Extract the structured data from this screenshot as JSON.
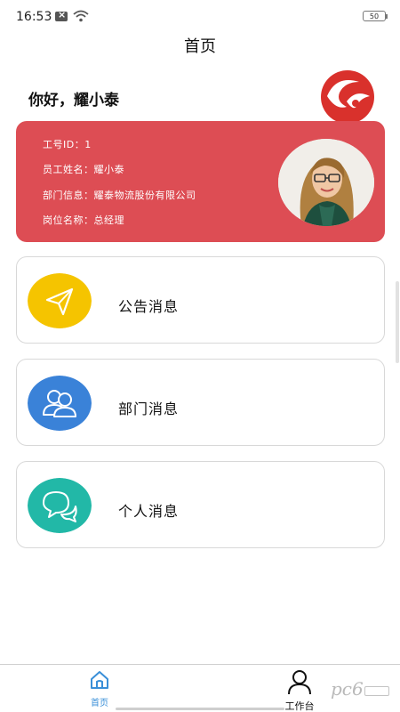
{
  "status": {
    "time": "16:53",
    "battery": "50"
  },
  "header": {
    "title": "首页"
  },
  "greeting": "你好，耀小泰",
  "profile": {
    "rows": [
      {
        "label": "工号ID：",
        "value": "1"
      },
      {
        "label": "员工姓名：",
        "value": "耀小泰"
      },
      {
        "label": "部门信息：",
        "value": "耀泰物流股份有限公司"
      },
      {
        "label": "岗位名称：",
        "value": "总经理"
      }
    ],
    "card_color": "#dd4d54"
  },
  "messages": [
    {
      "label": "公告消息",
      "icon": "send-icon",
      "color": "#f5c400"
    },
    {
      "label": "部门消息",
      "icon": "users-icon",
      "color": "#3a82d8"
    },
    {
      "label": "个人消息",
      "icon": "chat-icon",
      "color": "#22b8a7"
    }
  ],
  "tabs": [
    {
      "label": "首页",
      "icon": "home-icon",
      "active": true
    },
    {
      "label": "工作台",
      "icon": "person-icon",
      "active": false
    }
  ],
  "accent": "#3a8fd8"
}
